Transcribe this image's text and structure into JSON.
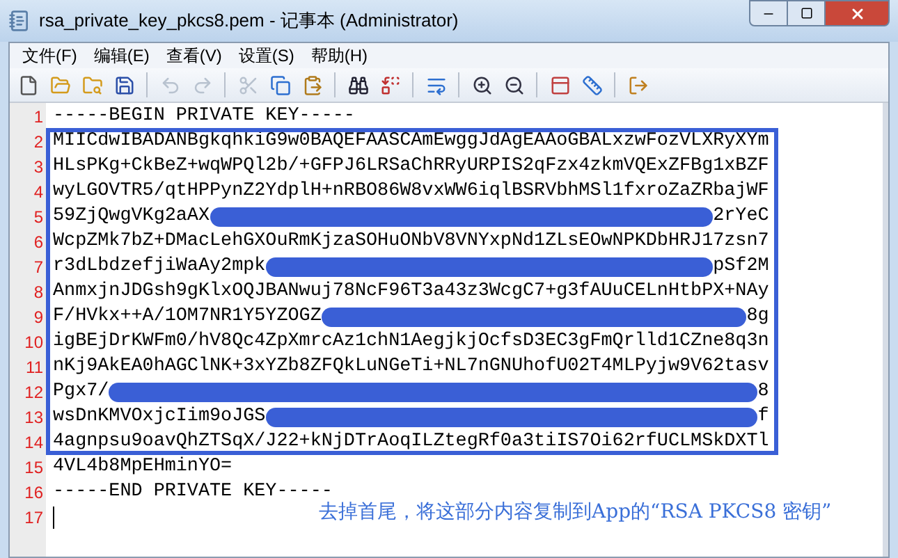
{
  "window": {
    "title": "rsa_private_key_pkcs8.pem - 记事本 (Administrator)"
  },
  "menu": [
    "文件(F)",
    "编辑(E)",
    "查看(V)",
    "设置(S)",
    "帮助(H)"
  ],
  "toolbar": [
    {
      "kind": "new",
      "disabled": false
    },
    {
      "kind": "open",
      "disabled": false
    },
    {
      "kind": "browse",
      "disabled": false
    },
    {
      "kind": "save",
      "disabled": false
    },
    {
      "kind": "sep"
    },
    {
      "kind": "undo",
      "disabled": true
    },
    {
      "kind": "redo",
      "disabled": true
    },
    {
      "kind": "sep"
    },
    {
      "kind": "cut",
      "disabled": true
    },
    {
      "kind": "copy",
      "disabled": false
    },
    {
      "kind": "paste",
      "disabled": false
    },
    {
      "kind": "sep"
    },
    {
      "kind": "find",
      "disabled": false
    },
    {
      "kind": "replace",
      "disabled": false
    },
    {
      "kind": "sep"
    },
    {
      "kind": "wrap",
      "disabled": false
    },
    {
      "kind": "sep"
    },
    {
      "kind": "zoom-in",
      "disabled": false
    },
    {
      "kind": "zoom-out",
      "disabled": false
    },
    {
      "kind": "sep"
    },
    {
      "kind": "view",
      "disabled": false
    },
    {
      "kind": "settings",
      "disabled": false
    },
    {
      "kind": "sep"
    },
    {
      "kind": "exit",
      "disabled": false
    }
  ],
  "editor": {
    "lines": [
      {
        "number": "1",
        "text": "-----BEGIN PRIVATE KEY-----"
      },
      {
        "number": "2",
        "text": "MIICdwIBADANBgkqhkiG9w0BAQEFAASCAmEwggJdAgEAAoGBALxzwFozVLXRyXYm"
      },
      {
        "number": "3",
        "text": "HLsPKg+CkBeZ+wqWPQl2b/+GFPJ6LRSaChRRyURPIS2qFzx4zkmVQExZFBg1xBZF"
      },
      {
        "number": "4",
        "text": "wyLGOVTR5/qtHPPynZ2YdplH+nRBO86W8vxWW6iqlBSRVbhMSl1fxroZaZRbajWF"
      },
      {
        "number": "5",
        "text": "59ZjQwgVKg2aAX",
        "redacted": true,
        "tail": "2rYeC"
      },
      {
        "number": "6",
        "text": "WcpZMk7bZ+DMacLehGXOuRmKjzaSOHuONbV8VNYxpNd1ZLsEOwNPKDbHRJ17zsn7"
      },
      {
        "number": "7",
        "text": "r3dLbdzefjiWaAy2mpk",
        "redacted": true,
        "tail": "pSf2M"
      },
      {
        "number": "8",
        "text": "AnmxjnJDGsh9gKlxOQJBANwuj78NcF96T3a43z3WcgC7+g3fAUuCELnHtbPX+NAy"
      },
      {
        "number": "9",
        "text": "F/HVkx++A/1OM7NR1Y5YZOGZ",
        "redacted": true,
        "tail": "8g"
      },
      {
        "number": "10",
        "text": "igBEjDrKWFm0/hV8Qc4ZpXmrcAz1chN1AegjkjOcfsD3EC3gFmQrlld1CZne8q3n"
      },
      {
        "number": "11",
        "text": "nKj9AkEA0hAGClNK+3xYZb8ZFQkLuNGeTi+NL7nGNUhofU02T4MLPyjw9V62tasv"
      },
      {
        "number": "12",
        "text": "Pgx7/",
        "redacted": true,
        "tail": "8"
      },
      {
        "number": "13",
        "text": "wsDnKMVOxjcIim9oJGS",
        "redacted": true,
        "tail": "f"
      },
      {
        "number": "14",
        "text": "4agnpsu9oavQhZTSqX/J22+kNjDTrAoqILZtegRf0a3tiIS7Oi62rfUCLMSkDXTl"
      },
      {
        "number": "15",
        "text": "4VL4b8MpEHminYO="
      },
      {
        "number": "16",
        "text": "-----END PRIVATE KEY-----"
      },
      {
        "number": "17",
        "cursor": true
      }
    ]
  },
  "annotation": "去掉首尾，将这部分内容复制到App的“RSA PKCS8 密钥”"
}
